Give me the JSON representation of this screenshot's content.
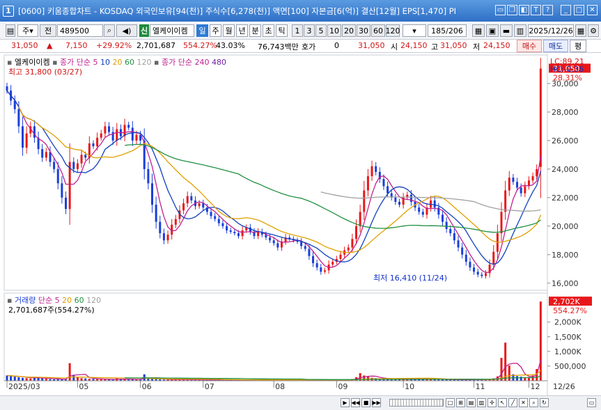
{
  "window": {
    "number": "1",
    "title": "[0600] 키움종합차트 - KOSDAQ 외국인보유[94(천)] 주식수[6,278(천)] 액면[100] 자본금[6(억)] 결산[12월] EPS[1,470] PI"
  },
  "toolbar": {
    "item1": "주",
    "item2": "전",
    "code": "489500",
    "badge": "신",
    "stock_name": "엘케이이켐",
    "periods": [
      "일",
      "주",
      "월",
      "년",
      "분",
      "초",
      "틱"
    ],
    "selected_period": "일",
    "intervals": [
      "1",
      "3",
      "5",
      "10",
      "20",
      "30",
      "60",
      "120"
    ],
    "count": "185",
    "total": "/206",
    "date": "2025/12/26"
  },
  "quote": {
    "price": "31,050",
    "arrow": "▲",
    "change": "7,150",
    "change_pct": "+29.92%",
    "volume": "2,701,687",
    "volume_pct": "554.27%",
    "turnover": "43.03%",
    "amount": "76,743백만",
    "hoga_label": "호가",
    "hoga_value": "0",
    "ask": "31,050",
    "open_label": "시",
    "open": "24,150",
    "high_label": "고",
    "high": "31,050",
    "low_label": "저",
    "low": "24,150",
    "buy": "매수",
    "sell": "매도",
    "eval": "평"
  },
  "price_legend": {
    "name": "엘케이이켐",
    "ma_label": "종가 단순 5",
    "ma_periods": [
      "10",
      "20",
      "60",
      "120"
    ],
    "ma2_label": "종가 단순 240",
    "ma2_period": "480",
    "high_note": "최고 31,800 (03/27)",
    "low_note": "최저 16,410 (11/24)",
    "lc": "LC:89.21",
    "hc": "HC:-2.36"
  },
  "volume_legend": {
    "label": "거래량",
    "ma_label": "단순 5",
    "ma_periods": [
      "20",
      "60",
      "120"
    ],
    "value": "2,701,687주(554.27%)"
  },
  "price_axis": {
    "ticks": [
      "30,000",
      "28,000",
      "26,000",
      "24,000",
      "22,000",
      "20,000",
      "18,000",
      "16,000"
    ],
    "last_price": "31,050",
    "last_pct": "28.31%"
  },
  "volume_axis": {
    "ticks": [
      "2,000K",
      "1,500K",
      "1,000K",
      "500,000"
    ],
    "last_volume": "2,702K",
    "last_pct": "554.27%"
  },
  "date_axis": {
    "labels": [
      "2025/03",
      "05",
      "06",
      "07",
      "08",
      "09",
      "10",
      "11",
      "12"
    ],
    "right_label": "12/26"
  },
  "colors": {
    "up": "#e8181a",
    "down": "#1a3fd8",
    "ma5": "#c02090",
    "ma10": "#1040c0",
    "ma20": "#e0a000",
    "ma60": "#209040",
    "ma120": "#a0a0a0"
  },
  "chart_data": {
    "type": "candlestick",
    "ylim": [
      15500,
      32000
    ],
    "x_start": "2025/03",
    "x_end": "12/26",
    "closes": [
      29500,
      28800,
      28200,
      27000,
      25500,
      26500,
      27000,
      26200,
      25400,
      24800,
      25200,
      24500,
      24000,
      23000,
      22000,
      21200,
      24500,
      24000,
      24400,
      25000,
      24800,
      25800,
      25600,
      26200,
      26500,
      27000,
      26600,
      26000,
      26800,
      26300,
      27100,
      26900,
      26000,
      26400,
      26000,
      24000,
      23000,
      21500,
      20300,
      19500,
      19000,
      19400,
      20100,
      20500,
      21100,
      21600,
      22100,
      21800,
      21400,
      21600,
      21300,
      21000,
      20700,
      20500,
      20200,
      20000,
      19700,
      19600,
      19500,
      19300,
      19700,
      19900,
      19600,
      19300,
      19600,
      19400,
      19200,
      19000,
      18800,
      18500,
      18900,
      19200,
      19100,
      19000,
      18900,
      18600,
      18400,
      17900,
      17400,
      17100,
      16800,
      16900,
      17300,
      17500,
      17700,
      18000,
      18300,
      18500,
      19100,
      20000,
      21000,
      22500,
      23500,
      24200,
      23800,
      23300,
      22800,
      22300,
      22000,
      21700,
      21500,
      22000,
      22200,
      21700,
      21300,
      21000,
      20800,
      21300,
      21800,
      21300,
      20800,
      20300,
      19800,
      19500,
      19000,
      18500,
      18000,
      17500,
      17100,
      16800,
      16600,
      16500,
      16700,
      17300,
      18200,
      19500,
      21000,
      22500,
      23400,
      23100,
      22700,
      22300,
      22800,
      23200,
      23500,
      24000,
      31050
    ],
    "volumes": [
      180,
      160,
      140,
      120,
      100,
      90,
      80,
      120,
      100,
      80,
      70,
      60,
      50,
      60,
      50,
      40,
      600,
      200,
      120,
      90,
      80,
      70,
      60,
      60,
      50,
      50,
      40,
      40,
      80,
      60,
      50,
      40,
      40,
      50,
      60,
      220,
      90,
      70,
      60,
      50,
      40,
      40,
      40,
      50,
      40,
      40,
      40,
      30,
      30,
      40,
      30,
      30,
      30,
      30,
      30,
      30,
      30,
      30,
      30,
      30,
      30,
      30,
      30,
      30,
      30,
      30,
      30,
      30,
      30,
      30,
      30,
      30,
      30,
      30,
      30,
      30,
      30,
      30,
      30,
      30,
      30,
      30,
      30,
      30,
      30,
      30,
      30,
      40,
      60,
      120,
      260,
      180,
      140,
      100,
      90,
      80,
      70,
      60,
      60,
      60,
      60,
      70,
      60,
      60,
      50,
      50,
      50,
      60,
      50,
      50,
      50,
      40,
      40,
      40,
      40,
      40,
      40,
      40,
      40,
      40,
      50,
      40,
      40,
      60,
      80,
      150,
      780,
      1300,
      520,
      220,
      160,
      140,
      120,
      110,
      180,
      400,
      2702
    ]
  }
}
